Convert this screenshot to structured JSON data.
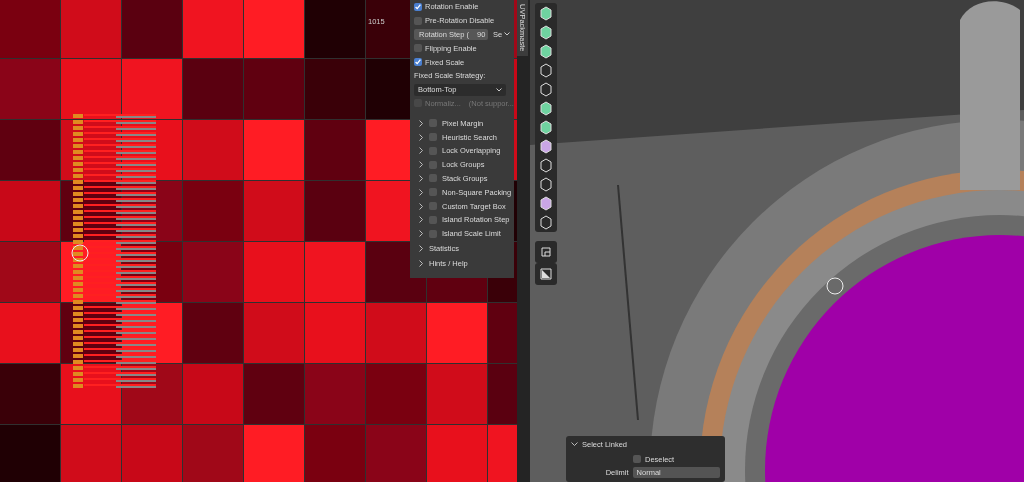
{
  "uv_editor": {
    "ruler_label": "1015"
  },
  "pack_panel": {
    "options": [
      {
        "kind": "checkbox",
        "label": "Rotation Enable",
        "checked": true
      },
      {
        "kind": "checkbox",
        "label": "Pre-Rotation Disable",
        "checked": false
      },
      {
        "kind": "number",
        "label": "Rotation Step (",
        "value": "90",
        "side": "Se"
      },
      {
        "kind": "checkbox",
        "label": "Flipping Enable",
        "checked": false
      },
      {
        "kind": "checkbox",
        "label": "Fixed Scale",
        "checked": true
      },
      {
        "kind": "heading",
        "label": "Fixed Scale Strategy:"
      },
      {
        "kind": "dropdown",
        "label": "Bottom-Top"
      },
      {
        "kind": "disabled",
        "label": "Normaliz...",
        "note": "(Not suppor...",
        "checked": false
      }
    ],
    "subpanels": [
      {
        "label": "Pixel Margin",
        "checked": false,
        "expanded": false
      },
      {
        "label": "Heuristic Search",
        "checked": false,
        "expanded": false
      },
      {
        "label": "Lock Overlapping",
        "checked": false,
        "expanded": false
      },
      {
        "label": "Lock Groups",
        "checked": false,
        "expanded": false
      },
      {
        "label": "Stack Groups",
        "checked": false,
        "expanded": false
      },
      {
        "label": "Non-Square Packing",
        "checked": false,
        "expanded": false
      },
      {
        "label": "Custom Target Box",
        "checked": false,
        "expanded": false
      },
      {
        "label": "Island Rotation Step",
        "checked": false,
        "expanded": false
      },
      {
        "label": "Island Scale Limit",
        "checked": false,
        "expanded": false
      }
    ],
    "sections": [
      {
        "label": "Statistics",
        "expanded": false
      },
      {
        "label": "Hints / Help",
        "expanded": false
      }
    ]
  },
  "sidebar_tab": {
    "label": "UVPackmaste"
  },
  "operator_panel": {
    "title": "Select Linked",
    "expanded": true,
    "deselect": {
      "label": "Deselect",
      "checked": false
    },
    "delimit": {
      "label": "Delimit",
      "value": "Normal"
    }
  }
}
